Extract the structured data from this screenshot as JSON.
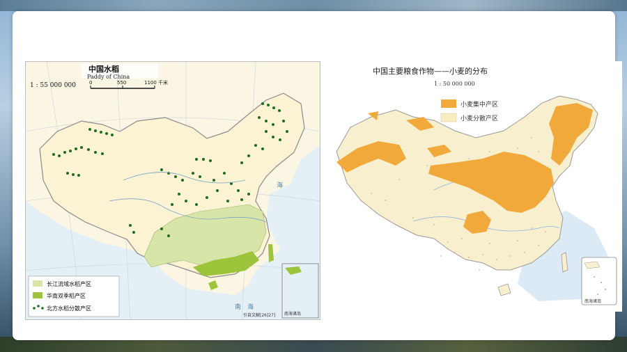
{
  "rice_map": {
    "title": "中国水稻",
    "subtitle": "Paddy of China",
    "scale_ratio": "1 : 55 000 000",
    "scale_ticks": [
      "0",
      "550",
      "1100 千米"
    ],
    "legend": [
      {
        "label": "长江流域水稻产区",
        "color": "#d7e6a8"
      },
      {
        "label": "华南双季稻产区",
        "color": "#9dc43b"
      },
      {
        "label": "北方水稻分散产区",
        "color": "#1f6b1f"
      }
    ],
    "source_note": "引自文献[26]27]",
    "inset_label": "南海诸岛",
    "sea_labels": [
      "海",
      "南",
      "海"
    ]
  },
  "wheat_map": {
    "title": "中国主要粮食作物——小麦的分布",
    "scale_ratio": "1 : 50 000 000",
    "legend": [
      {
        "label": "小麦集中产区",
        "color": "#f2a93b"
      },
      {
        "label": "小麦分散产区",
        "color": "#f7ecc2"
      }
    ],
    "inset_label": "南海诸岛"
  },
  "colors": {
    "land": "#f5f0d6",
    "sea": "#d4e6f2",
    "wheat_concentrated": "#f2a93b",
    "wheat_scattered": "#f8efcf",
    "rice_yangtze": "#d7e6a8",
    "rice_south": "#9dc43b",
    "rice_north_dot": "#1f6b1f"
  }
}
